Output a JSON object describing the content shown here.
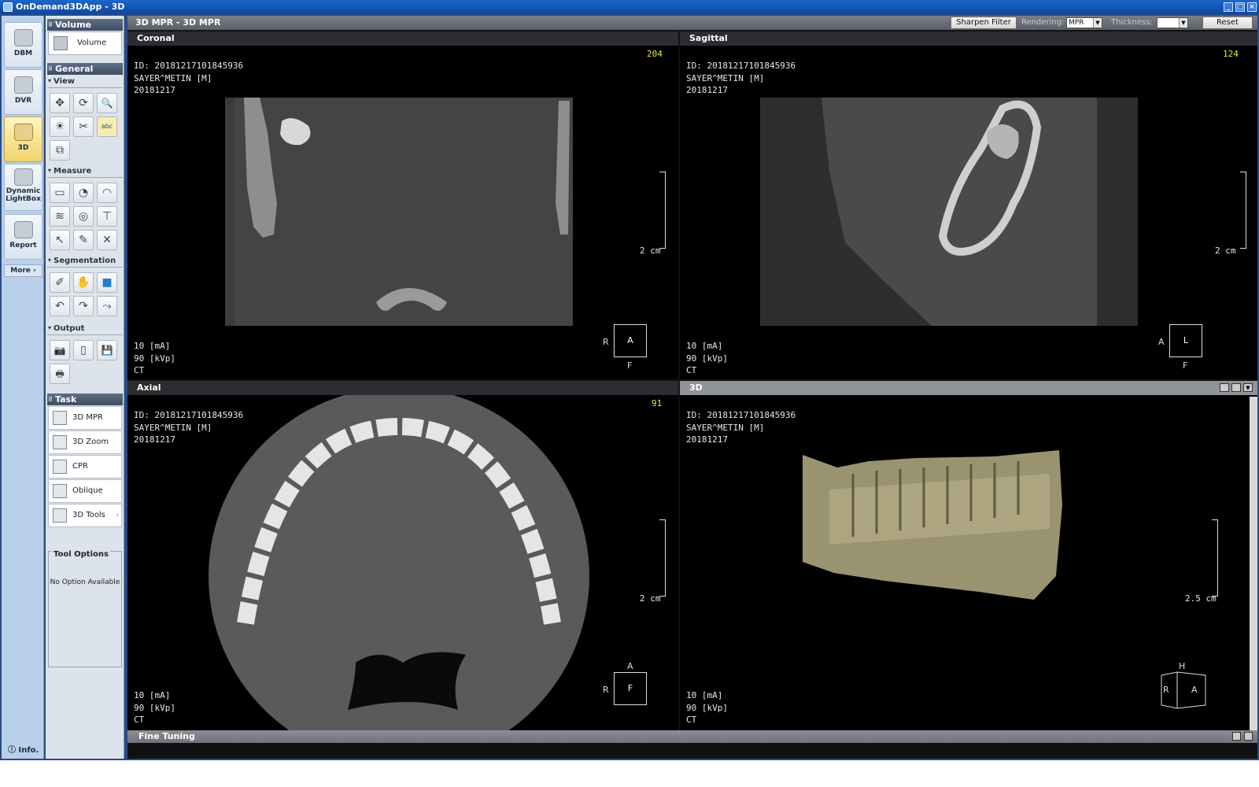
{
  "window": {
    "title": "OnDemand3DApp - 3D"
  },
  "rail": {
    "items": [
      {
        "label": "DBM",
        "icon": "dbm-icon"
      },
      {
        "label": "DVR",
        "icon": "tooth-icon"
      },
      {
        "label": "3D",
        "icon": "3d-tooth-icon",
        "active": true
      },
      {
        "label": "Dynamic LightBox",
        "icon": "lightbox-icon"
      },
      {
        "label": "Report",
        "icon": "report-icon"
      }
    ],
    "more": "More",
    "info": "Info."
  },
  "tools": {
    "volume_header": "Volume",
    "volume_button": "Volume",
    "general_header": "General",
    "view_header": "View",
    "view_tools": [
      "✥",
      "⟳",
      "🔍",
      "☀",
      "✂",
      "abc",
      "⧉"
    ],
    "measure_header": "Measure",
    "measure_tools": [
      "▭",
      "◔",
      "◠",
      "≋",
      "◎",
      "⊤",
      "↖",
      "✎",
      "✕"
    ],
    "segmentation_header": "Segmentation",
    "segmentation_tools": [
      "✐",
      "✋",
      "■",
      "↶",
      "↷",
      "⤳"
    ],
    "output_header": "Output",
    "output_tools": [
      "📷",
      "▯",
      "💾",
      "🖶"
    ],
    "task_header": "Task",
    "tasks": [
      "3D MPR",
      "3D Zoom",
      "CPR",
      "Oblique",
      "3D Tools"
    ],
    "tool_options_title": "Tool Options",
    "tool_options_empty": "No Option Available"
  },
  "topbar": {
    "title": "3D MPR - 3D MPR",
    "sharpen": "Sharpen Filter",
    "rendering_label": "Rendering:",
    "rendering_value": "MPR",
    "thickness_label": "Thickness:",
    "thickness_value": "",
    "reset": "Reset"
  },
  "patient": {
    "id": "ID: 20181217101845936",
    "name": "SAYER^METIN [M]",
    "date": "20181217",
    "ma": "10 [mA]",
    "kvp": "90 [kVp]",
    "modality": "CT"
  },
  "views": {
    "coronal": {
      "title": "Coronal",
      "slice": "204",
      "scale": "2 cm",
      "box": "A",
      "left": "R",
      "bottom": "F"
    },
    "sagittal": {
      "title": "Sagittal",
      "slice": "124",
      "scale": "2 cm",
      "box": "L",
      "left": "A",
      "bottom": "F"
    },
    "axial": {
      "title": "Axial",
      "slice": "91",
      "scale": "2 cm",
      "box": "F",
      "left": "R",
      "top": "A"
    },
    "three_d": {
      "title": "3D",
      "scale": "2.5 cm",
      "top": "H",
      "left": "R",
      "right": "A"
    }
  },
  "bottombar": {
    "title": "Fine Tuning"
  }
}
